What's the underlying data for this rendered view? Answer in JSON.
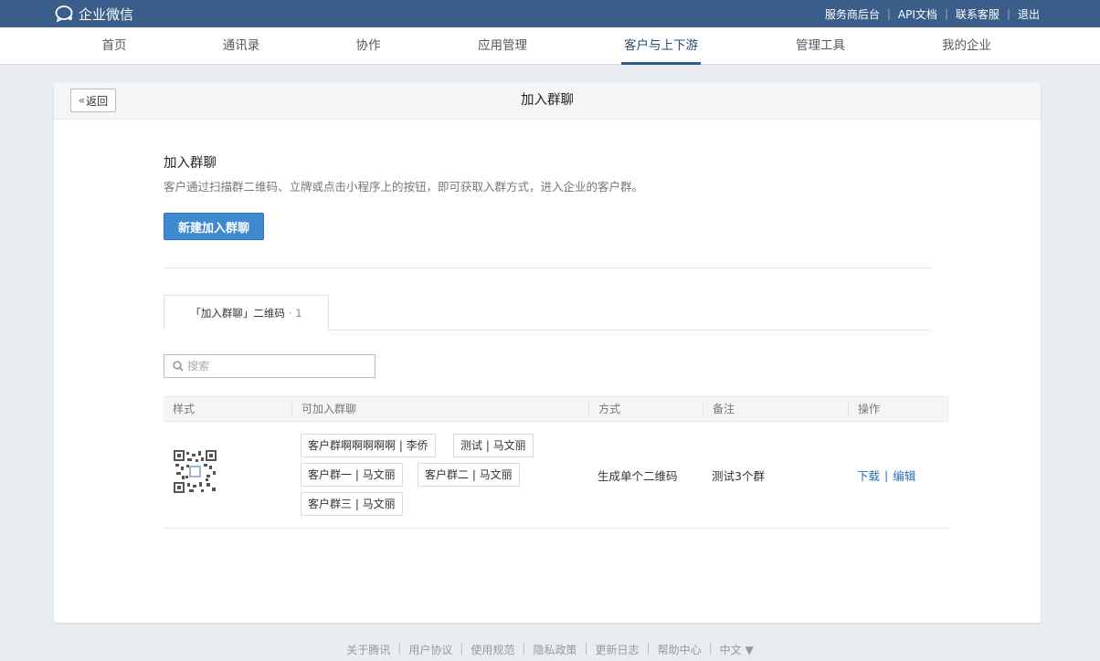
{
  "topbar": {
    "brand": "企业微信",
    "links": [
      "服务商后台",
      "API文档",
      "联系客服",
      "退出"
    ]
  },
  "nav": {
    "items": [
      "首页",
      "通讯录",
      "协作",
      "应用管理",
      "客户与上下游",
      "管理工具",
      "我的企业"
    ],
    "active": "客户与上下游"
  },
  "page": {
    "back_label": "返回",
    "title": "加入群聊"
  },
  "section": {
    "title": "加入群聊",
    "description": "客户通过扫描群二维码、立牌或点击小程序上的按钮，即可获取入群方式，进入企业的客户群。",
    "create_button": "新建加入群聊"
  },
  "tab": {
    "label": "「加入群聊」二维码",
    "count": "· 1"
  },
  "search": {
    "placeholder": "搜索"
  },
  "table": {
    "headers": [
      "样式",
      "可加入群聊",
      "方式",
      "备注",
      "操作"
    ],
    "rows": [
      {
        "groups": [
          "客户群啊啊啊啊啊 | 李侨",
          "测试 | 马文丽",
          "客户群一 | 马文丽",
          "客户群二 | 马文丽",
          "客户群三 | 马文丽"
        ],
        "method": "生成单个二维码",
        "note": "测试3个群",
        "actions": [
          "下载",
          "编辑"
        ]
      }
    ]
  },
  "footer": {
    "links": [
      "关于腾讯",
      "用户协议",
      "使用规范",
      "隐私政策",
      "更新日志",
      "帮助中心"
    ],
    "language": "中文 ▼"
  }
}
